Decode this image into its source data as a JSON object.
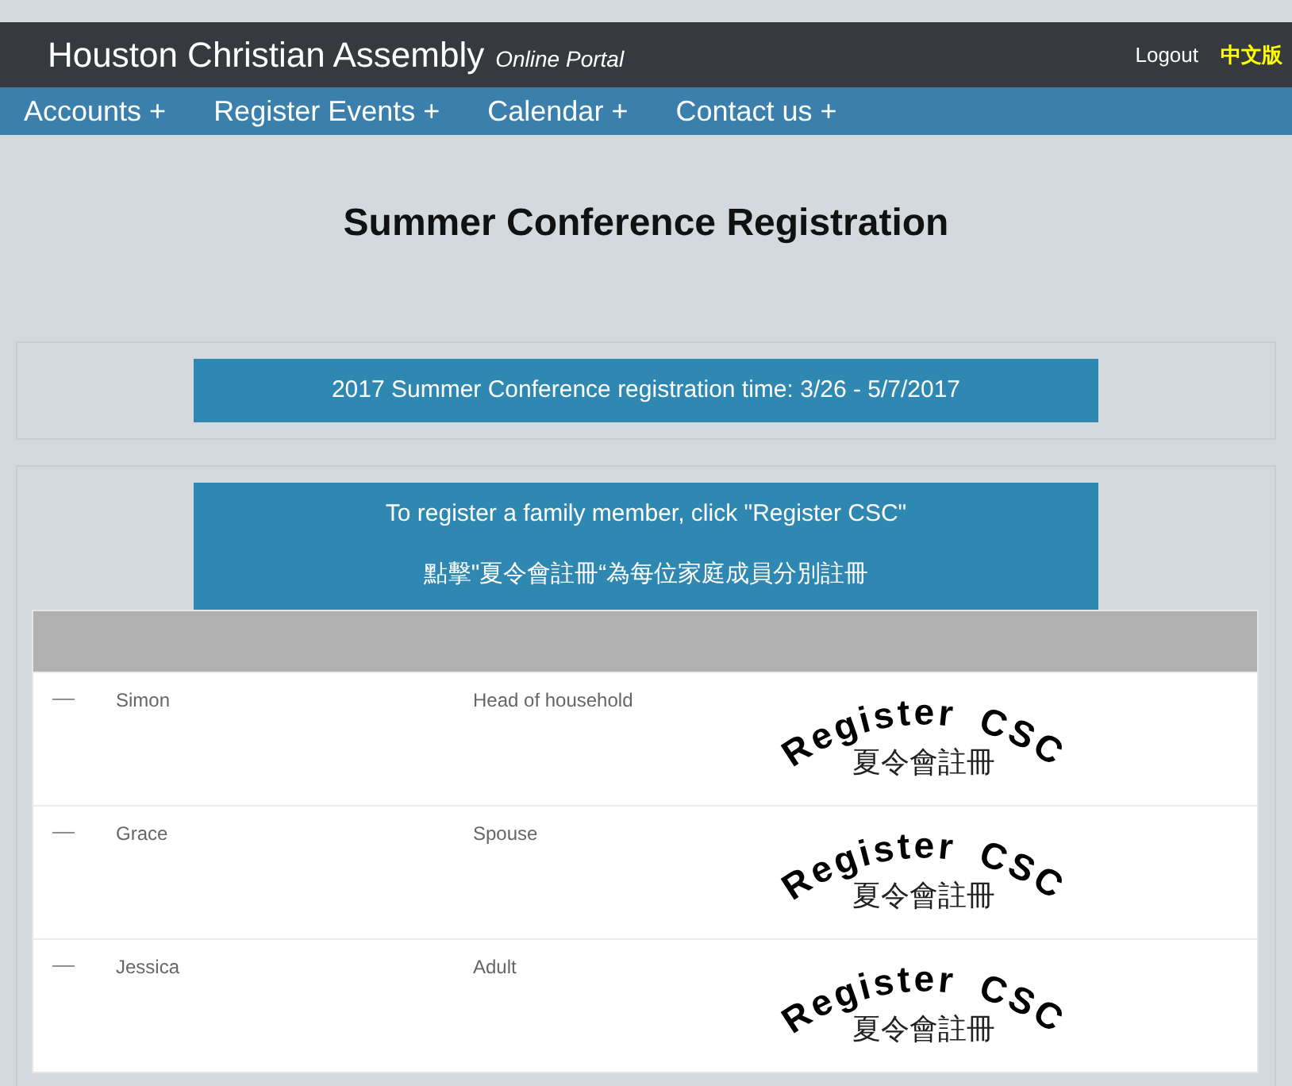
{
  "header": {
    "title": "Houston Christian Assembly",
    "tagline": "Online Portal",
    "links": [
      {
        "label": "Logout",
        "kind": "plain"
      },
      {
        "label": "中文版",
        "kind": "language"
      }
    ]
  },
  "nav": [
    {
      "label": "Accounts +"
    },
    {
      "label": "Register Events +"
    },
    {
      "label": "Calendar +"
    },
    {
      "label": "Contact us +"
    }
  ],
  "page_title": "Summer Conference Registration",
  "notice": "2017 Summer Conference registration time: 3/26 - 5/7/2017",
  "instructions": [
    "To register a family member, click \"Register CSC\"",
    "點擊\"夏令會註冊“為每位家庭成員分別註冊"
  ],
  "members": [
    {
      "marker": "—",
      "name": "Simon",
      "relation": "Head of household",
      "action": {
        "arc_text": "Register CSC",
        "subtext": "夏令會註冊"
      }
    },
    {
      "marker": "—",
      "name": "Grace",
      "relation": "Spouse",
      "action": {
        "arc_text": "Register CSC",
        "subtext": "夏令會註冊"
      }
    },
    {
      "marker": "—",
      "name": "Jessica",
      "relation": "Adult",
      "action": {
        "arc_text": "Register CSC",
        "subtext": "夏令會註冊"
      }
    }
  ]
}
